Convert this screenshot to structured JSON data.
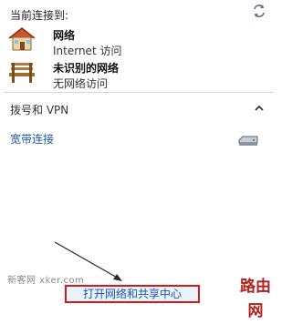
{
  "header": {
    "label": "当前连接到:",
    "refresh_icon": "refresh-icon"
  },
  "networks": [
    {
      "name": "网络",
      "status": "Internet 访问",
      "icon": "house-network-icon"
    },
    {
      "name": "未识别的网络",
      "status": "无网络访问",
      "icon": "bench-network-icon"
    }
  ],
  "section": {
    "label": "拨号和 VPN",
    "collapse_icon": "chevron-up-icon"
  },
  "connection": {
    "label": "宽带连接",
    "icon": "modem-icon"
  },
  "footer": {
    "link": "打开网络和共享中心"
  },
  "watermark": {
    "left": "新客网 xker.com",
    "right": "路由网"
  },
  "colors": {
    "link": "#1c56a8",
    "highlight": "#d11a1a",
    "watermark_right": "#b22020"
  }
}
